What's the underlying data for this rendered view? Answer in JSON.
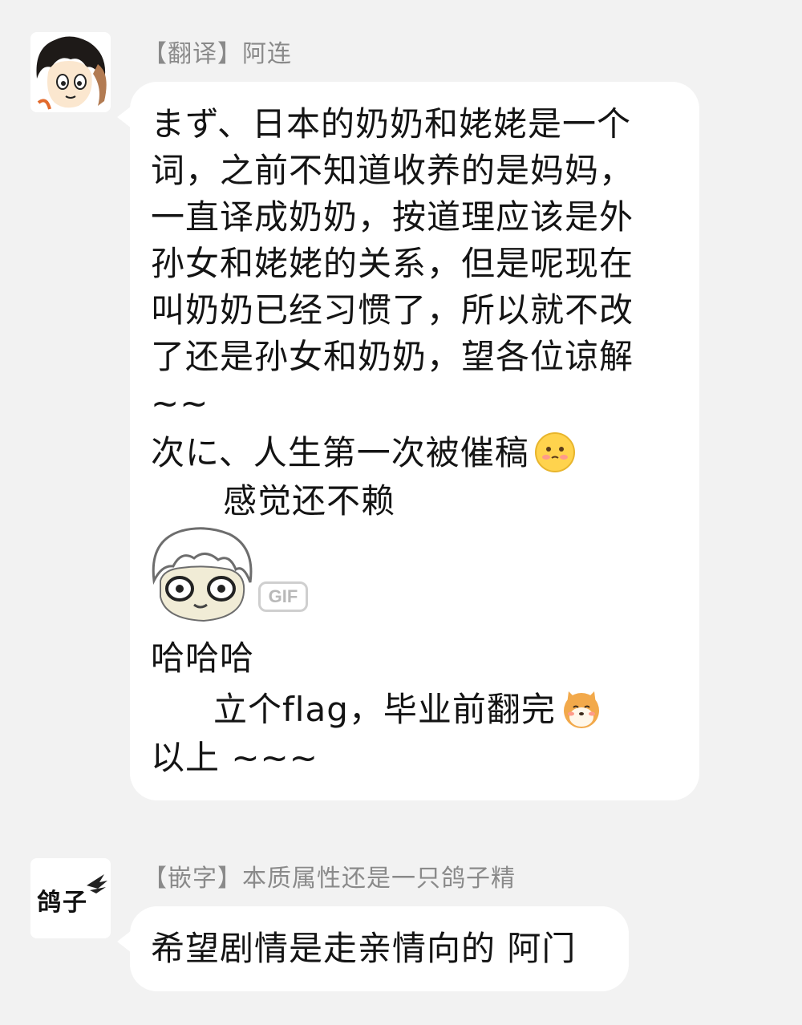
{
  "messages": [
    {
      "sender": "【翻译】阿连",
      "avatar_icon": "anime-boy-avatar-icon",
      "lines": [
        "まず、日本的奶奶和姥姥是一个",
        "词，之前不知道收养的是妈妈，",
        "一直译成奶奶，按道理应该是外",
        "孙女和姥姥的关系，但是呢现在",
        "叫奶奶已经习惯了，所以就不改",
        "了还是孙女和奶奶，望各位谅解",
        "~~",
        "次に、人生第一次被催稿",
        "感觉还不赖",
        "哈哈哈",
        "立个flag，毕业前翻完",
        "以上 ~~~"
      ],
      "gif_badge": "GIF",
      "sticker_icon": "wide-eyed-sticker-icon",
      "emoji_1": "blushing-face-emoji-icon",
      "emoji_2": "shiba-dog-emoji-icon"
    },
    {
      "sender": "【嵌字】本质属性还是一只鸽子精",
      "avatar_text": "鸽子",
      "lines": [
        "希望剧情是走亲情向的 阿门"
      ]
    }
  ],
  "colors": {
    "background": "#f2f2f2",
    "bubble": "#ffffff",
    "sender_text": "#8a8a8a",
    "message_text": "#141414",
    "emoji_yellow": "#ffd34d"
  }
}
